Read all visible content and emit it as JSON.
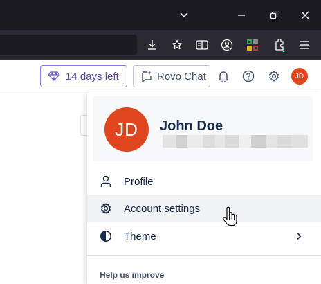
{
  "browser": {
    "titlebar_icons": [
      "chevron-down-icon",
      "minimize-icon",
      "restore-icon",
      "close-icon"
    ],
    "toolbar_icons": [
      "download-icon",
      "bookmark-star-icon",
      "reader-view-icon",
      "account-icon",
      "extension-grid-icon",
      "extensions-icon",
      "menu-icon"
    ]
  },
  "header": {
    "trial_label": "14 days left",
    "rovo_label": "Rovo Chat",
    "avatar_initials": "JD",
    "icons": [
      "notifications-icon",
      "help-icon",
      "settings-icon"
    ]
  },
  "profile_menu": {
    "avatar_initials": "JD",
    "user_name": "John Doe",
    "items": [
      {
        "label": "Profile",
        "icon": "person-icon"
      },
      {
        "label": "Account settings",
        "icon": "gear-icon",
        "hovered": true
      },
      {
        "label": "Theme",
        "icon": "theme-contrast-icon",
        "submenu": true
      }
    ],
    "section_title": "Help us improve"
  },
  "colors": {
    "avatar": "#e0461e",
    "trial_accent": "#5e4db2",
    "text": "#172b4d",
    "browser_dark": "#1c1b22",
    "browser_toolbar": "#2b2a33"
  }
}
